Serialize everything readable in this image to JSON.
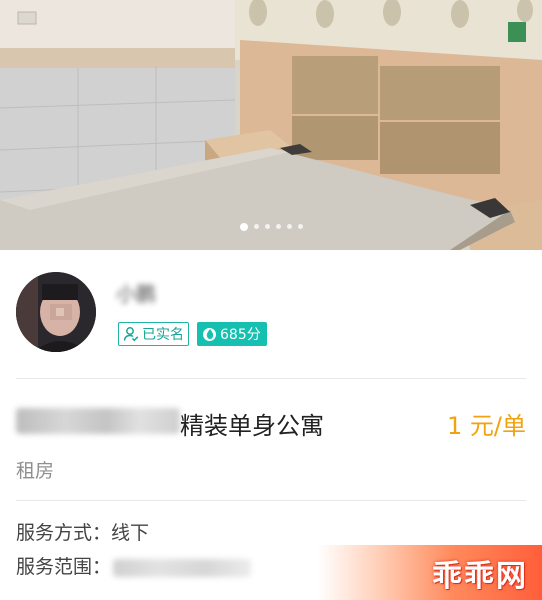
{
  "gallery": {
    "page_count": 6,
    "active_index": 0
  },
  "seller": {
    "name": "小鹏",
    "verified_label": "已实名",
    "credit_score": "685分"
  },
  "listing": {
    "title": "精装单身公寓",
    "price": "1 元/单",
    "category": "租房",
    "service_mode_label": "服务方式：",
    "service_mode_value": "线下",
    "service_area_label": "服务范围："
  },
  "watermark": {
    "text": "乖乖网"
  },
  "colors": {
    "accent": "#15c0b1",
    "price": "#f2a20c",
    "watermark": "#ff5f3a"
  }
}
